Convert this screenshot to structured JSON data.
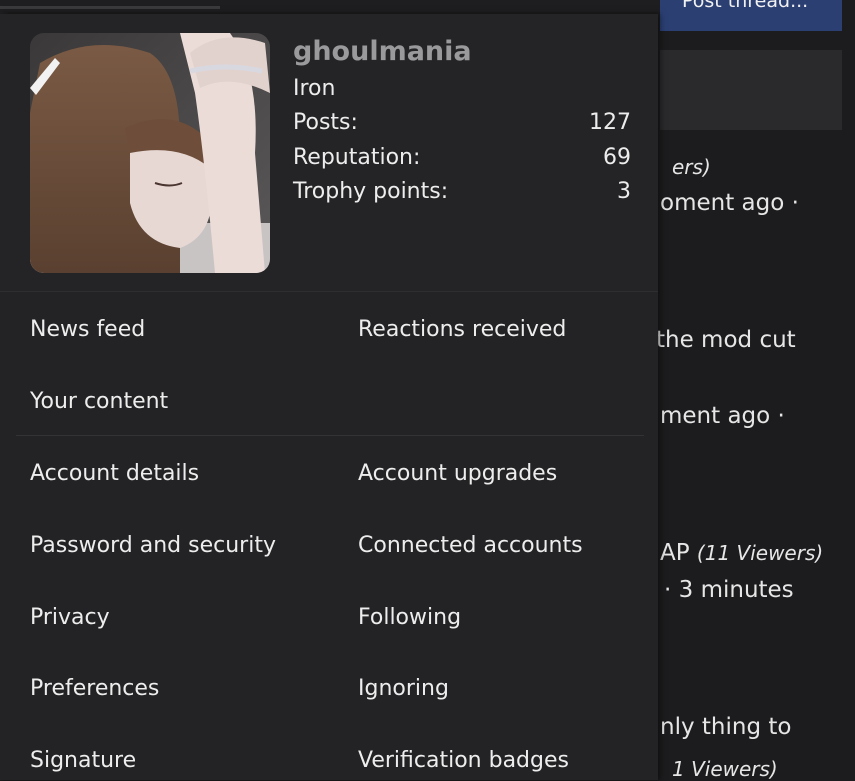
{
  "background": {
    "post_thread_label": "Post thread...",
    "snippets": [
      "ers)",
      "oment ago ·",
      "the mod cut",
      "ment ago ·",
      "AP",
      "(11 Viewers)",
      "· 3 minutes",
      "nly thing to",
      "1 Viewers)"
    ]
  },
  "profile": {
    "username": "ghoulmania",
    "rank": "Iron",
    "stats": [
      {
        "label": "Posts:",
        "value": "127"
      },
      {
        "label": "Reputation:",
        "value": "69"
      },
      {
        "label": "Trophy points:",
        "value": "3"
      }
    ]
  },
  "menu": {
    "news_feed": "News feed",
    "reactions_received": "Reactions received",
    "your_content": "Your content",
    "account_details": "Account details",
    "account_upgrades": "Account upgrades",
    "password_security": "Password and security",
    "connected_accounts": "Connected accounts",
    "privacy": "Privacy",
    "following": "Following",
    "preferences": "Preferences",
    "ignoring": "Ignoring",
    "signature": "Signature",
    "verification_badges": "Verification badges"
  }
}
